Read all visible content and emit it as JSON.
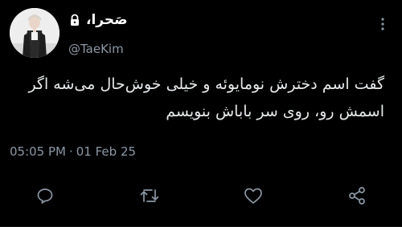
{
  "author": {
    "display_name": "صَحرا،",
    "handle": "@TaeKim",
    "locked": true
  },
  "tweet": {
    "line1": "گفت اسم دخترش نومایوئه و خیلی خوش‌حال می‌شه اگر",
    "line2": "اسمش رو، روی سر باباش بنویسم"
  },
  "meta": {
    "time": "05:05 PM",
    "separator": "·",
    "date": "01 Feb 25"
  },
  "actions": [
    "reply-icon",
    "retweet-icon",
    "like-icon",
    "share-icon"
  ],
  "colors": {
    "background": "#000000",
    "text": "#e7e9ea",
    "secondary": "#8b98a5"
  }
}
